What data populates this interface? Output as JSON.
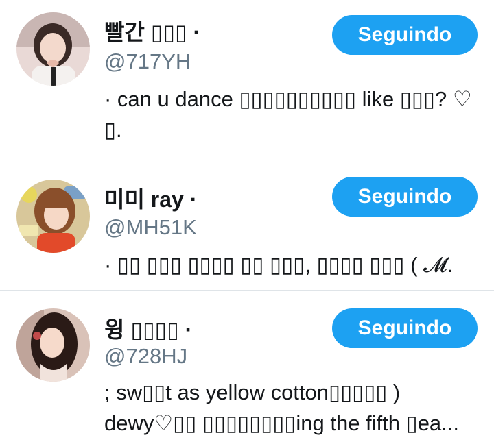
{
  "users": [
    {
      "name": "빨간 ▯▯▯ ·",
      "handle": "@717YH",
      "bio": "· can u dance ▯▯▯▯▯▯▯▯▯▯ like ▯▯▯? ♡ ▯.",
      "button_label": "Seguindo",
      "avatar_desc": "girl making heart hands"
    },
    {
      "name": "미미 ray ·",
      "handle": "@MH51K",
      "bio": "· ▯▯ ▯▯▯ ▯▯▯▯ ▯▯ ▯▯▯, ▯▯▯▯ ▯▯▯ ( 𝓜.",
      "button_label": "Seguindo",
      "avatar_desc": "girl with bangs and party decorations"
    },
    {
      "name": "윙 ▯▯▯▯ ·",
      "handle": "@728HJ",
      "bio": "; sw▯▯t as yellow cotton▯▯▯▯▯ ) dewy♡▯▯ ▯▯▯▯▯▯▯▯ing the fifth ▯ea...",
      "button_label": "Seguindo",
      "avatar_desc": "girl with long dark hair"
    }
  ],
  "colors": {
    "accent": "#1da1f2",
    "secondary_text": "#657786",
    "divider": "#dfe4e8"
  }
}
